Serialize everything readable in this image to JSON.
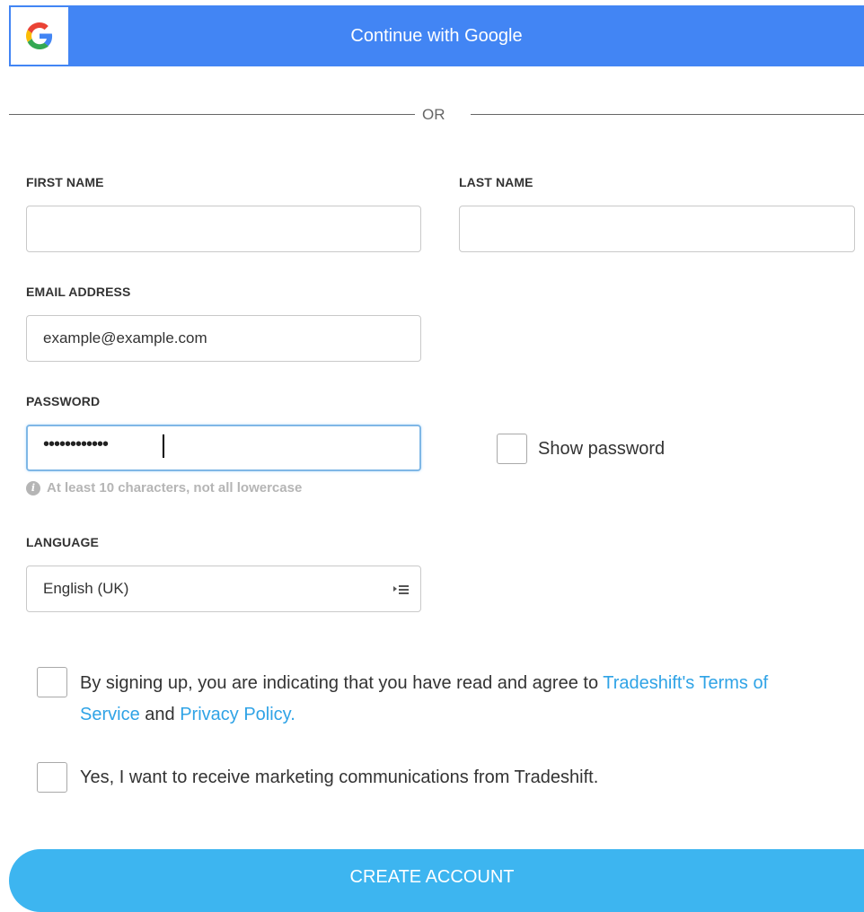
{
  "google_button": {
    "label": "Continue with Google",
    "icon": "google-g-icon"
  },
  "divider": {
    "text": "OR"
  },
  "form": {
    "first_name": {
      "label": "FIRST NAME",
      "value": ""
    },
    "last_name": {
      "label": "LAST NAME",
      "value": ""
    },
    "email": {
      "label": "EMAIL ADDRESS",
      "value": "example@example.com"
    },
    "password": {
      "label": "PASSWORD",
      "mask": "••••••••••••",
      "hint": "At least 10 characters, not all lowercase",
      "show_label": "Show password"
    },
    "language": {
      "label": "LANGUAGE",
      "selected": "English (UK)"
    }
  },
  "terms": {
    "prefix": "By signing up, you are indicating that you have read and agree to",
    "link1": "Tradeshift's Terms of Service",
    "and": "and",
    "link2": "Privacy Policy."
  },
  "marketing": {
    "label": "Yes, I want to receive marketing communications from Tradeshift."
  },
  "create_button": {
    "label": "CREATE ACCOUNT"
  },
  "colors": {
    "google_blue": "#4285f4",
    "cta_blue": "#3db5f0",
    "link_blue": "#2fa3e6"
  }
}
